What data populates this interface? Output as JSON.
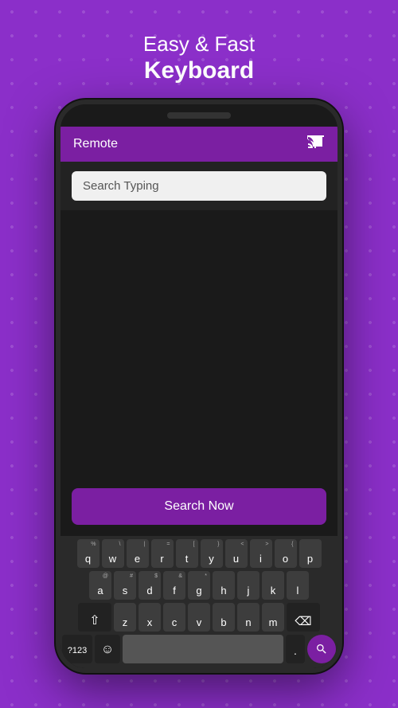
{
  "header": {
    "line1": "Easy & Fast",
    "line2": "Keyboard"
  },
  "app": {
    "toolbar": {
      "title": "Remote",
      "cast_icon": "⬛"
    },
    "search_input": {
      "placeholder": "Search Typing"
    },
    "search_button": {
      "label": "Search Now"
    }
  },
  "keyboard": {
    "rows": [
      {
        "keys": [
          {
            "letter": "q",
            "super": "%"
          },
          {
            "letter": "w",
            "super": "\\"
          },
          {
            "letter": "e",
            "super": "|"
          },
          {
            "letter": "r",
            "super": "="
          },
          {
            "letter": "t",
            "super": "["
          },
          {
            "letter": "y",
            "super": "}"
          },
          {
            "letter": "u",
            "super": "<"
          },
          {
            "letter": "i",
            "super": ">"
          },
          {
            "letter": "o",
            "super": "{"
          },
          {
            "letter": "p",
            "super": ""
          }
        ]
      },
      {
        "keys": [
          {
            "letter": "a",
            "super": "@"
          },
          {
            "letter": "s",
            "super": "#"
          },
          {
            "letter": "d",
            "super": "$"
          },
          {
            "letter": "f",
            "super": "&"
          },
          {
            "letter": "g",
            "super": "*"
          },
          {
            "letter": "h",
            "super": ""
          },
          {
            "letter": "j",
            "super": ""
          },
          {
            "letter": "k",
            "super": ""
          },
          {
            "letter": "l",
            "super": ""
          }
        ]
      },
      {
        "keys": [
          {
            "letter": "z",
            "super": ""
          },
          {
            "letter": "x",
            "super": ""
          },
          {
            "letter": "c",
            "super": ""
          },
          {
            "letter": "v",
            "super": ""
          },
          {
            "letter": "b",
            "super": ""
          },
          {
            "letter": "n",
            "super": ""
          },
          {
            "letter": "m",
            "super": ""
          }
        ]
      }
    ],
    "bottom": {
      "num_label": "?123",
      "period_label": ".",
      "search_icon": "🔍"
    }
  },
  "colors": {
    "purple": "#7B1FA2",
    "background": "#8B2FC9"
  }
}
